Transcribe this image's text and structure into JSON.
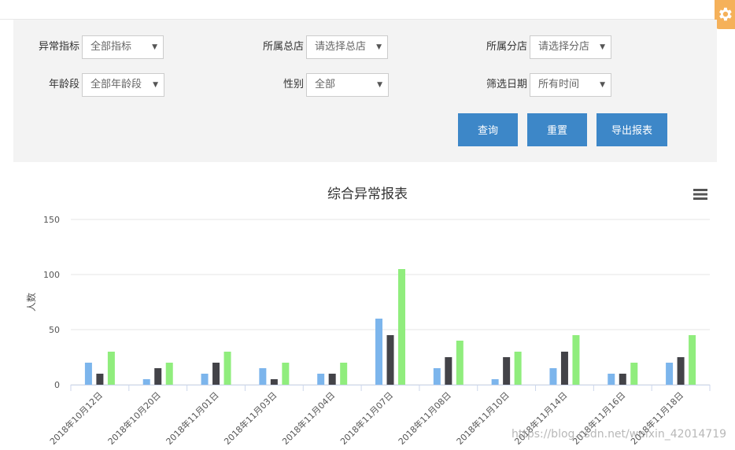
{
  "filters": {
    "row1": [
      {
        "label": "异常指标",
        "value": "全部指标"
      },
      {
        "label": "所属总店",
        "value": "请选择总店"
      },
      {
        "label": "所属分店",
        "value": "请选择分店"
      }
    ],
    "row2": [
      {
        "label": "年龄段",
        "value": "全部年龄段"
      },
      {
        "label": "性别",
        "value": "全部"
      },
      {
        "label": "筛选日期",
        "value": "所有时间"
      }
    ]
  },
  "buttons": {
    "query": "查询",
    "reset": "重置",
    "export": "导出报表"
  },
  "icons": {
    "settings": "gear-icon",
    "chart_menu": "hamburger-menu-icon"
  },
  "colors": {
    "button": "#3d87c8",
    "settings_tab": "#f5b15a",
    "panel_bg": "#f3f3f3"
  },
  "chart_data": {
    "type": "bar",
    "title": "综合异常报表",
    "ylabel": "人数",
    "xlabel": "",
    "ylim": [
      0,
      150
    ],
    "yticks": [
      0,
      50,
      100,
      150
    ],
    "grid": true,
    "categories": [
      "2018年10月12日",
      "2018年10月20日",
      "2018年11月01日",
      "2018年11月03日",
      "2018年11月04日",
      "2018年11月07日",
      "2018年11月08日",
      "2018年11月10日",
      "2018年11月14日",
      "2018年11月16日",
      "2018年11月18日"
    ],
    "series": [
      {
        "color": "#7cb5ec",
        "values": [
          20,
          5,
          10,
          15,
          10,
          60,
          15,
          5,
          15,
          10,
          20
        ]
      },
      {
        "color": "#434348",
        "values": [
          10,
          15,
          20,
          5,
          10,
          45,
          25,
          25,
          30,
          10,
          25
        ]
      },
      {
        "color": "#90ed7d",
        "values": [
          30,
          20,
          30,
          20,
          20,
          105,
          40,
          30,
          45,
          20,
          45
        ]
      }
    ]
  },
  "watermark": "https://blog.csdn.net/weixin_42014719"
}
